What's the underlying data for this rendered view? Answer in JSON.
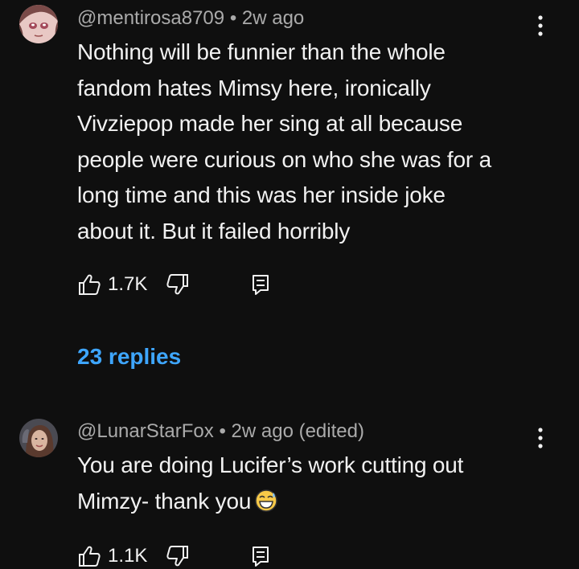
{
  "comments": [
    {
      "handle": "@mentirosa8709",
      "separator": "•",
      "time": "2w ago",
      "edited": "",
      "lines": [
        "Nothing will be funnier than the whole",
        "fandom hates Mimsy here, ironically",
        "Vivziepop made her sing at all because",
        "people were curious on who she was for a",
        "long time and this was her inside joke",
        "about it. But it failed horribly"
      ],
      "likes": "1.7K",
      "replies": "23 replies"
    },
    {
      "handle": "@LunarStarFox",
      "separator": "•",
      "time": "2w ago",
      "edited": "(edited)",
      "lines": [
        "You are doing Lucifer’s work cutting out",
        "Mimzy- thank you"
      ],
      "emoji": "grinning-sweat-emoji",
      "likes": "1.1K"
    }
  ],
  "icons": {
    "like": "thumbs-up-icon",
    "dislike": "thumbs-down-icon",
    "reply": "reply-icon",
    "menu": "kebab-menu-icon"
  },
  "colors": {
    "background": "#0f0f0f",
    "text": "#f1f1f1",
    "meta": "#aaaaaa",
    "link": "#3ea6ff"
  }
}
